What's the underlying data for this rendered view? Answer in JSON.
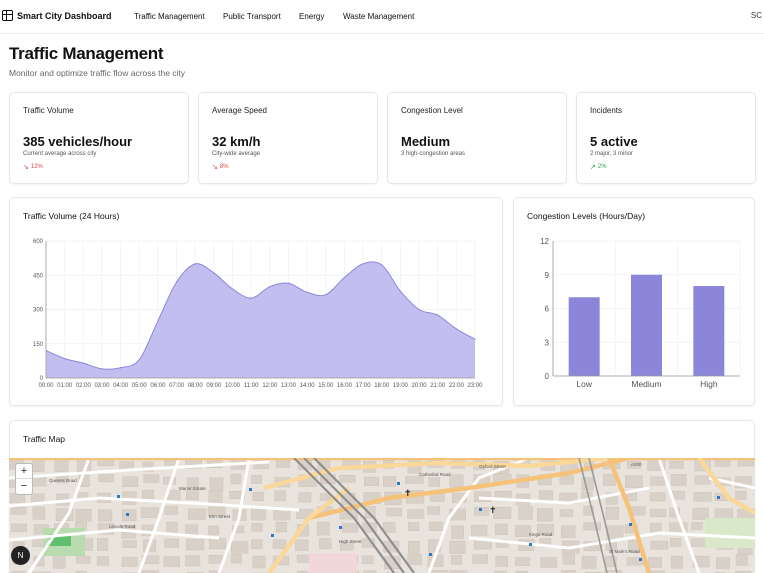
{
  "header": {
    "brand": "Smart City Dashboard",
    "brand_icon": "city-grid-icon",
    "nav": [
      "Traffic Management",
      "Public Transport",
      "Energy",
      "Waste Management"
    ],
    "user_initials": "SC"
  },
  "page": {
    "title": "Traffic Management",
    "subtitle": "Monitor and optimize traffic flow across the city"
  },
  "stats": [
    {
      "label": "Traffic Volume",
      "value": "385 vehicles/hour",
      "desc": "Current average across city",
      "trend": "12%",
      "trend_dir": "down"
    },
    {
      "label": "Average Speed",
      "value": "32 km/h",
      "desc": "City-wide average",
      "trend": "8%",
      "trend_dir": "down"
    },
    {
      "label": "Congestion Level",
      "value": "Medium",
      "desc": "3 high-congestion areas"
    },
    {
      "label": "Incidents",
      "value": "5 active",
      "desc": "2 major, 3 minor",
      "trend": "2%",
      "trend_dir": "up"
    }
  ],
  "colors": {
    "accent": "#8b86d9",
    "area_fill": "#c2bff0",
    "trend_down": "#e04343",
    "trend_up": "#27a34b"
  },
  "chart_data": [
    {
      "type": "area",
      "title": "Traffic Volume (24 Hours)",
      "x": [
        "00:00",
        "01:00",
        "02:00",
        "03:00",
        "04:00",
        "05:00",
        "06:00",
        "07:00",
        "08:00",
        "09:00",
        "10:00",
        "11:00",
        "12:00",
        "13:00",
        "14:00",
        "15:00",
        "16:00",
        "17:00",
        "18:00",
        "19:00",
        "20:00",
        "21:00",
        "22:00",
        "23:00"
      ],
      "values": [
        120,
        85,
        65,
        40,
        45,
        80,
        250,
        420,
        500,
        460,
        390,
        350,
        400,
        415,
        375,
        365,
        440,
        500,
        495,
        380,
        300,
        275,
        215,
        170
      ],
      "ylim": [
        0,
        600
      ],
      "yticks": [
        0,
        150,
        300,
        450,
        600
      ],
      "grid": true
    },
    {
      "type": "bar",
      "title": "Congestion Levels (Hours/Day)",
      "categories": [
        "Low",
        "Medium",
        "High"
      ],
      "values": [
        7,
        9,
        8
      ],
      "ylim": [
        0,
        12
      ],
      "yticks": [
        0,
        3,
        6,
        9,
        12
      ],
      "grid": true
    }
  ],
  "map": {
    "title": "Traffic Map",
    "zoom_in": "+",
    "zoom_out": "−",
    "compass": "N",
    "labels": [
      "Lincoln Road",
      "Manor Estate",
      "Queens Road",
      "Cathedral Road",
      "Kings Road",
      "Elm Street",
      "St Mark's Road",
      "A200",
      "Oxford Street",
      "High Street"
    ]
  }
}
